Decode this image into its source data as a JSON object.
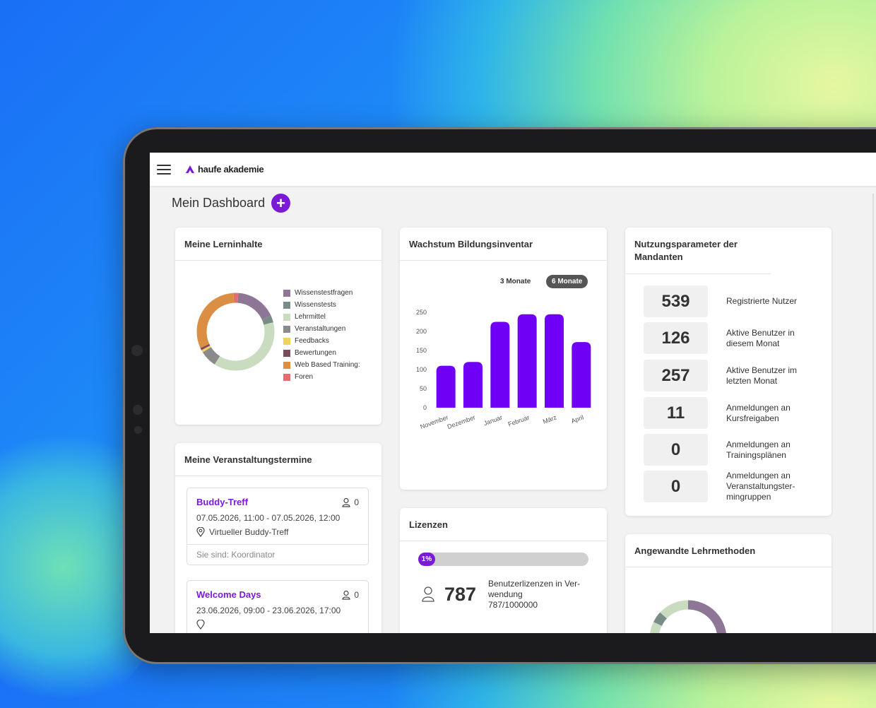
{
  "brand": {
    "name": "haufe akademie",
    "accent": "#7a1ad8"
  },
  "dashboard": {
    "title": "Mein Dashboard",
    "add_label": "+"
  },
  "lerninhalte": {
    "title": "Meine Lerninhalte",
    "legend": [
      {
        "label": "Wissenstestfragen",
        "color": "#8e7696",
        "value": 17
      },
      {
        "label": "Wissenstests",
        "color": "#7a8c86",
        "value": 3
      },
      {
        "label": "Lehrmittel",
        "color": "#c9dcc0",
        "value": 38
      },
      {
        "label": "Veranstaltungen",
        "color": "#8a8a8a",
        "value": 7
      },
      {
        "label": "Feedbacks",
        "color": "#f2d15e",
        "value": 1
      },
      {
        "label": "Bewertungen",
        "color": "#7d4a5c",
        "value": 1
      },
      {
        "label": "Web Based Training:",
        "color": "#db8f45",
        "value": 31
      },
      {
        "label": "Foren",
        "color": "#e07070",
        "value": 2
      }
    ]
  },
  "wachstum": {
    "title": "Wachstum Bildungsinventar",
    "toggle_3": "3 Monate",
    "toggle_6": "6 Monate",
    "active_toggle": "6 Monate",
    "bar_color": "#7000f5"
  },
  "chart_data": {
    "type": "bar",
    "categories": [
      "November",
      "Dezember",
      "Januar",
      "Februar",
      "März",
      "April"
    ],
    "values": [
      110,
      120,
      225,
      245,
      245,
      172
    ],
    "ylim": [
      0,
      250
    ],
    "yticks": [
      0,
      50,
      100,
      150,
      200,
      250
    ],
    "grid": false
  },
  "nutzung": {
    "title": "Nutzungsparameter der Mandanten",
    "stats": [
      {
        "value": "539",
        "label": "Registrierte Nutzer"
      },
      {
        "value": "126",
        "label": "Aktive Benutzer in diesem Monat"
      },
      {
        "value": "257",
        "label": "Aktive Benutzer im letzten Monat"
      },
      {
        "value": "11",
        "label": "Anmeldungen an Kursfreigaben"
      },
      {
        "value": "0",
        "label": "Anmeldungen an Trainingsplänen"
      },
      {
        "value": "0",
        "label": "Anmeldungen an Veranstaltungster-mingruppen"
      }
    ]
  },
  "veranstaltungen": {
    "title": "Meine Veranstaltungstermine",
    "events": [
      {
        "title": "Buddy-Treff",
        "count": "0",
        "date": "07.05.2026, 11:00 - 07.05.2026, 12:00",
        "location": "Virtueller Buddy-Treff",
        "role": "Sie sind: Koordinator"
      },
      {
        "title": "Welcome Days",
        "count": "0",
        "date": "23.06.2026, 09:00 - 23.06.2026, 17:00",
        "location": "",
        "role": ""
      }
    ]
  },
  "lizenzen": {
    "title": "Lizenzen",
    "progress_label": "1%",
    "progress_fraction": 0.0008,
    "count": "787",
    "label": "Benutzerlizenzen in Ver-wendung",
    "ratio": "787/1000000"
  },
  "lehrmethoden": {
    "title": "Angewandte Lehrmethoden"
  }
}
